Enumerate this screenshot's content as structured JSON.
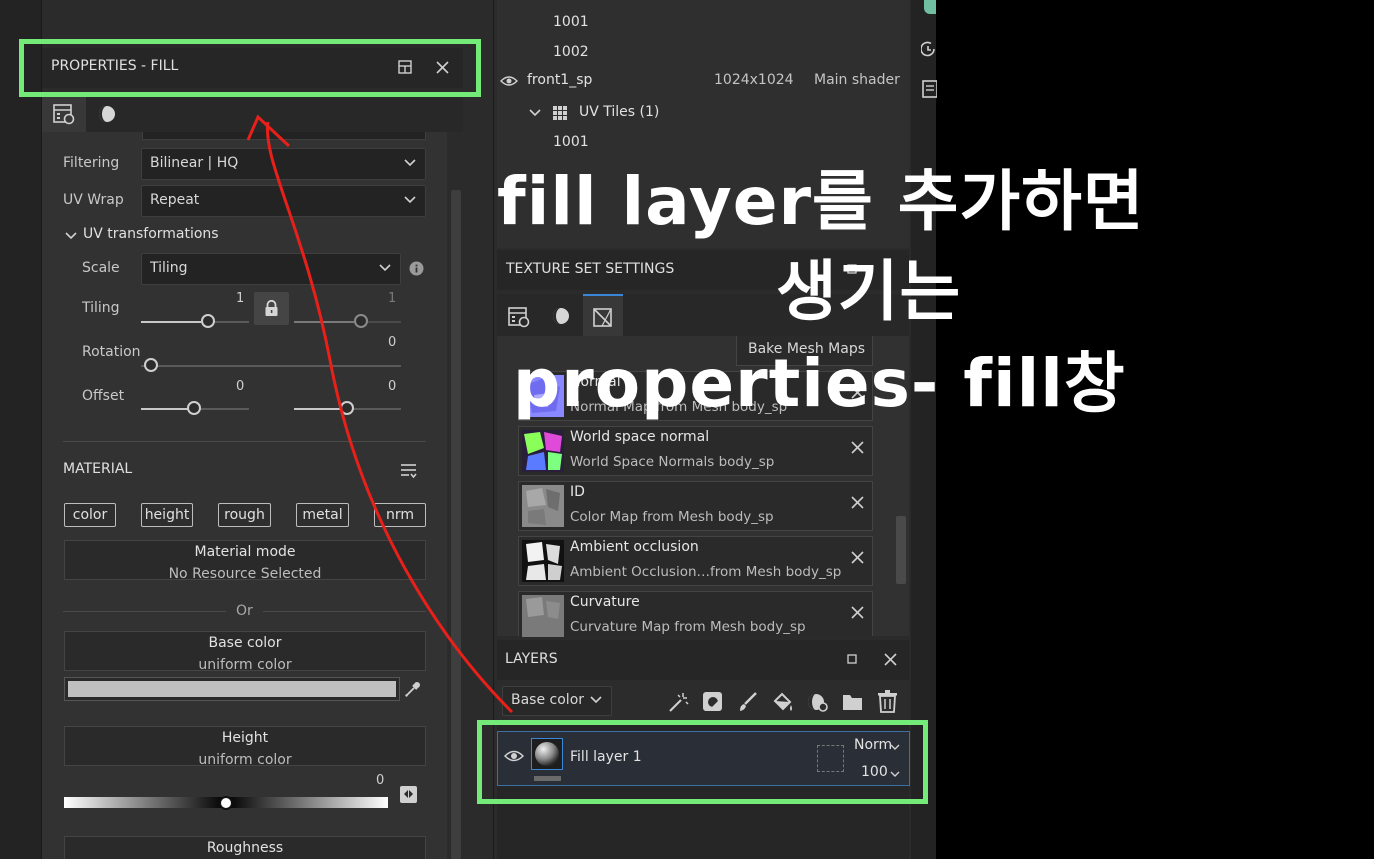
{
  "properties_panel": {
    "title": "PROPERTIES - FILL",
    "filtering": {
      "label": "Filtering",
      "value": "Bilinear | HQ"
    },
    "uv_wrap": {
      "label": "UV Wrap",
      "value": "Repeat"
    },
    "uv_transformations": {
      "label": "UV transformations",
      "scale": {
        "label": "Scale",
        "value": "Tiling"
      },
      "tiling": {
        "label": "Tiling",
        "u": "1",
        "v": "1"
      },
      "rotation": {
        "label": "Rotation",
        "value": "0"
      },
      "offset": {
        "label": "Offset",
        "u": "0",
        "v": "0"
      }
    },
    "material": {
      "label": "MATERIAL",
      "channels": [
        "color",
        "height",
        "rough",
        "metal",
        "nrm"
      ],
      "material_mode": {
        "title": "Material mode",
        "value": "No Resource Selected"
      },
      "or_label": "Or",
      "base_color": {
        "title": "Base color",
        "value": "uniform color",
        "swatch": "#c0c0c0"
      },
      "height": {
        "title": "Height",
        "value": "uniform color",
        "slider_value": "0"
      },
      "roughness": {
        "title": "Roughness"
      }
    }
  },
  "texture_set_list": {
    "rows": [
      {
        "name": "1001"
      },
      {
        "name": "1002"
      },
      {
        "name": "front1_sp",
        "resolution": "1024x1024",
        "shader": "Main shader"
      },
      {
        "name": "UV Tiles (1)"
      },
      {
        "name": "1001"
      }
    ]
  },
  "texture_set_settings": {
    "title": "TEXTURE SET SETTINGS",
    "bake_button": "Bake Mesh Maps",
    "maps": [
      {
        "title": "Normal",
        "subtitle": "Normal Map from Mesh body_sp"
      },
      {
        "title": "World space normal",
        "subtitle": "World Space Normals body_sp"
      },
      {
        "title": "ID",
        "subtitle": "Color Map from Mesh body_sp"
      },
      {
        "title": "Ambient occlusion",
        "subtitle": "Ambient Occlusion…from Mesh body_sp"
      },
      {
        "title": "Curvature",
        "subtitle": "Curvature Map from Mesh body_sp"
      }
    ]
  },
  "layers": {
    "title": "LAYERS",
    "channel_select": "Base color",
    "layer": {
      "name": "Fill layer 1",
      "blend": "Norm",
      "opacity": "100"
    }
  },
  "annotation": {
    "line1": "fill layer를 추가하면",
    "line2": "생기는",
    "line3": "properties- fill창",
    "highlight_color": "#74ea78",
    "arrow_color": "#e8201a"
  }
}
